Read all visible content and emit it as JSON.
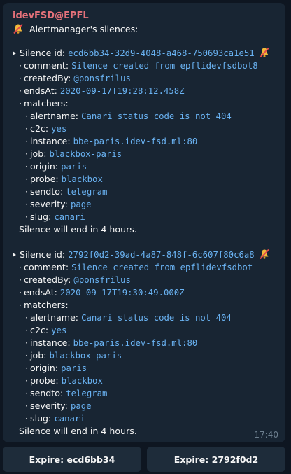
{
  "sender": "idevFSD@EPFL",
  "header_text": "Alertmanager's silences:",
  "silences": [
    {
      "id_label": "Silence id:",
      "id": "ecd6bb34-32d9-4048-a468-750693ca1e51",
      "comment_label": "comment:",
      "comment": "Silence created from epflidevfsdbot8",
      "created_label": "createdBy:",
      "created_by": "@ponsfrilus",
      "ends_label": "endsAt:",
      "ends_at": "2020-09-17T19:28:12.458Z",
      "matchers_label": "matchers:",
      "matchers": [
        {
          "key": "alertname:",
          "value": "Canari status code is not 404"
        },
        {
          "key": "c2c:",
          "value": "yes"
        },
        {
          "key": "instance:",
          "value": "bbe-paris.idev-fsd.ml:80"
        },
        {
          "key": "job:",
          "value": "blackbox-paris"
        },
        {
          "key": "origin:",
          "value": "paris"
        },
        {
          "key": "probe:",
          "value": "blackbox"
        },
        {
          "key": "sendto:",
          "value": "telegram"
        },
        {
          "key": "severity:",
          "value": "page"
        },
        {
          "key": "slug:",
          "value": "canari"
        }
      ],
      "status": "Silence will end in 4 hours."
    },
    {
      "id_label": "Silence id:",
      "id": "2792f0d2-39ad-4a87-848f-6c607f80c6a8",
      "comment_label": "comment:",
      "comment": "Silence created from epflidevfsdbot",
      "created_label": "createdBy:",
      "created_by": "@ponsfrilus",
      "ends_label": "endsAt:",
      "ends_at": "2020-09-17T19:30:49.000Z",
      "matchers_label": "matchers:",
      "matchers": [
        {
          "key": "alertname:",
          "value": "Canari status code is not 404"
        },
        {
          "key": "c2c:",
          "value": "yes"
        },
        {
          "key": "instance:",
          "value": "bbe-paris.idev-fsd.ml:80"
        },
        {
          "key": "job:",
          "value": "blackbox-paris"
        },
        {
          "key": "origin:",
          "value": "paris"
        },
        {
          "key": "probe:",
          "value": "blackbox"
        },
        {
          "key": "sendto:",
          "value": "telegram"
        },
        {
          "key": "severity:",
          "value": "page"
        },
        {
          "key": "slug:",
          "value": "canari"
        }
      ],
      "status": "Silence will end in 4 hours."
    }
  ],
  "time": "17:40",
  "buttons": {
    "expire_1": "Expire: ecd6bb34",
    "expire_2": "Expire: 2792f0d2"
  },
  "icons": {
    "bell": "muted-bell-icon"
  },
  "colors": {
    "background": "#0e1621",
    "bubble": "#182533",
    "sender": "#e4717a",
    "mono_text": "#6ab3f3",
    "button": "#1e2c3a"
  }
}
